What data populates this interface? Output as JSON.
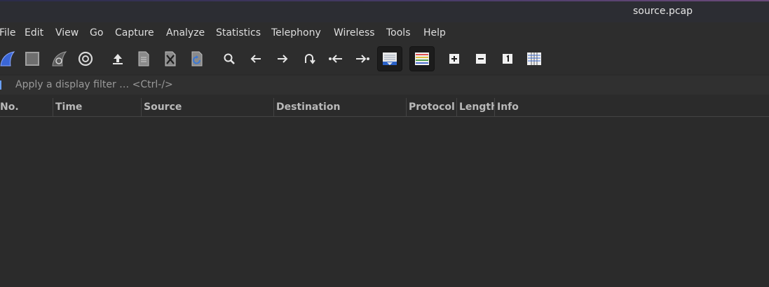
{
  "window": {
    "title": "source.pcap"
  },
  "menu": [
    "File",
    "Edit",
    "View",
    "Go",
    "Capture",
    "Analyze",
    "Statistics",
    "Telephony",
    "Wireless",
    "Tools",
    "Help"
  ],
  "toolbar": {
    "icons": [
      "start-capture-icon",
      "stop-capture-icon",
      "restart-capture-icon",
      "capture-options-icon",
      "open-file-icon",
      "save-file-icon",
      "close-file-icon",
      "reload-file-icon",
      "find-packet-icon",
      "go-back-icon",
      "go-forward-icon",
      "go-to-packet-icon",
      "first-packet-icon",
      "last-packet-icon",
      "auto-scroll-icon",
      "colorize-icon",
      "zoom-in-icon",
      "zoom-out-icon",
      "normal-size-icon",
      "resize-columns-icon"
    ]
  },
  "filter": {
    "placeholder": "Apply a display filter … <Ctrl-/>",
    "value": ""
  },
  "columns": [
    "No.",
    "Time",
    "Source",
    "Destination",
    "Protocol",
    "Length",
    "Info"
  ],
  "colors": {
    "accent": "#6aa0ff",
    "background": "#2b2b2b"
  }
}
